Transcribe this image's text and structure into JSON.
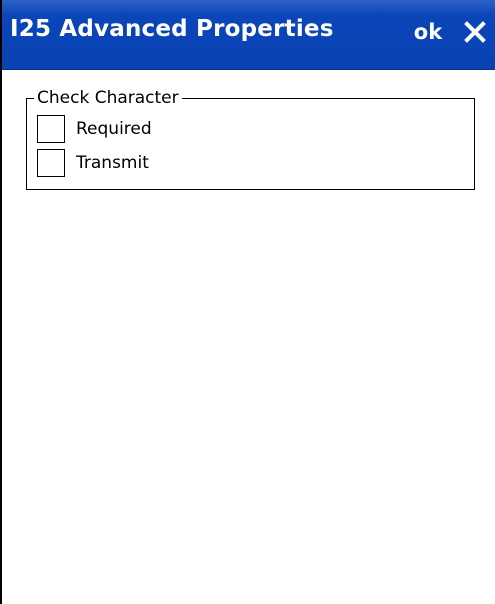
{
  "window": {
    "title": "I25 Advanced Properties",
    "ok_label": "ok",
    "close_icon": "close-icon",
    "accent_color": "#0a44b6"
  },
  "group": {
    "legend": "Check Character",
    "options": [
      {
        "label": "Required",
        "checked": false
      },
      {
        "label": "Transmit",
        "checked": false
      }
    ]
  }
}
